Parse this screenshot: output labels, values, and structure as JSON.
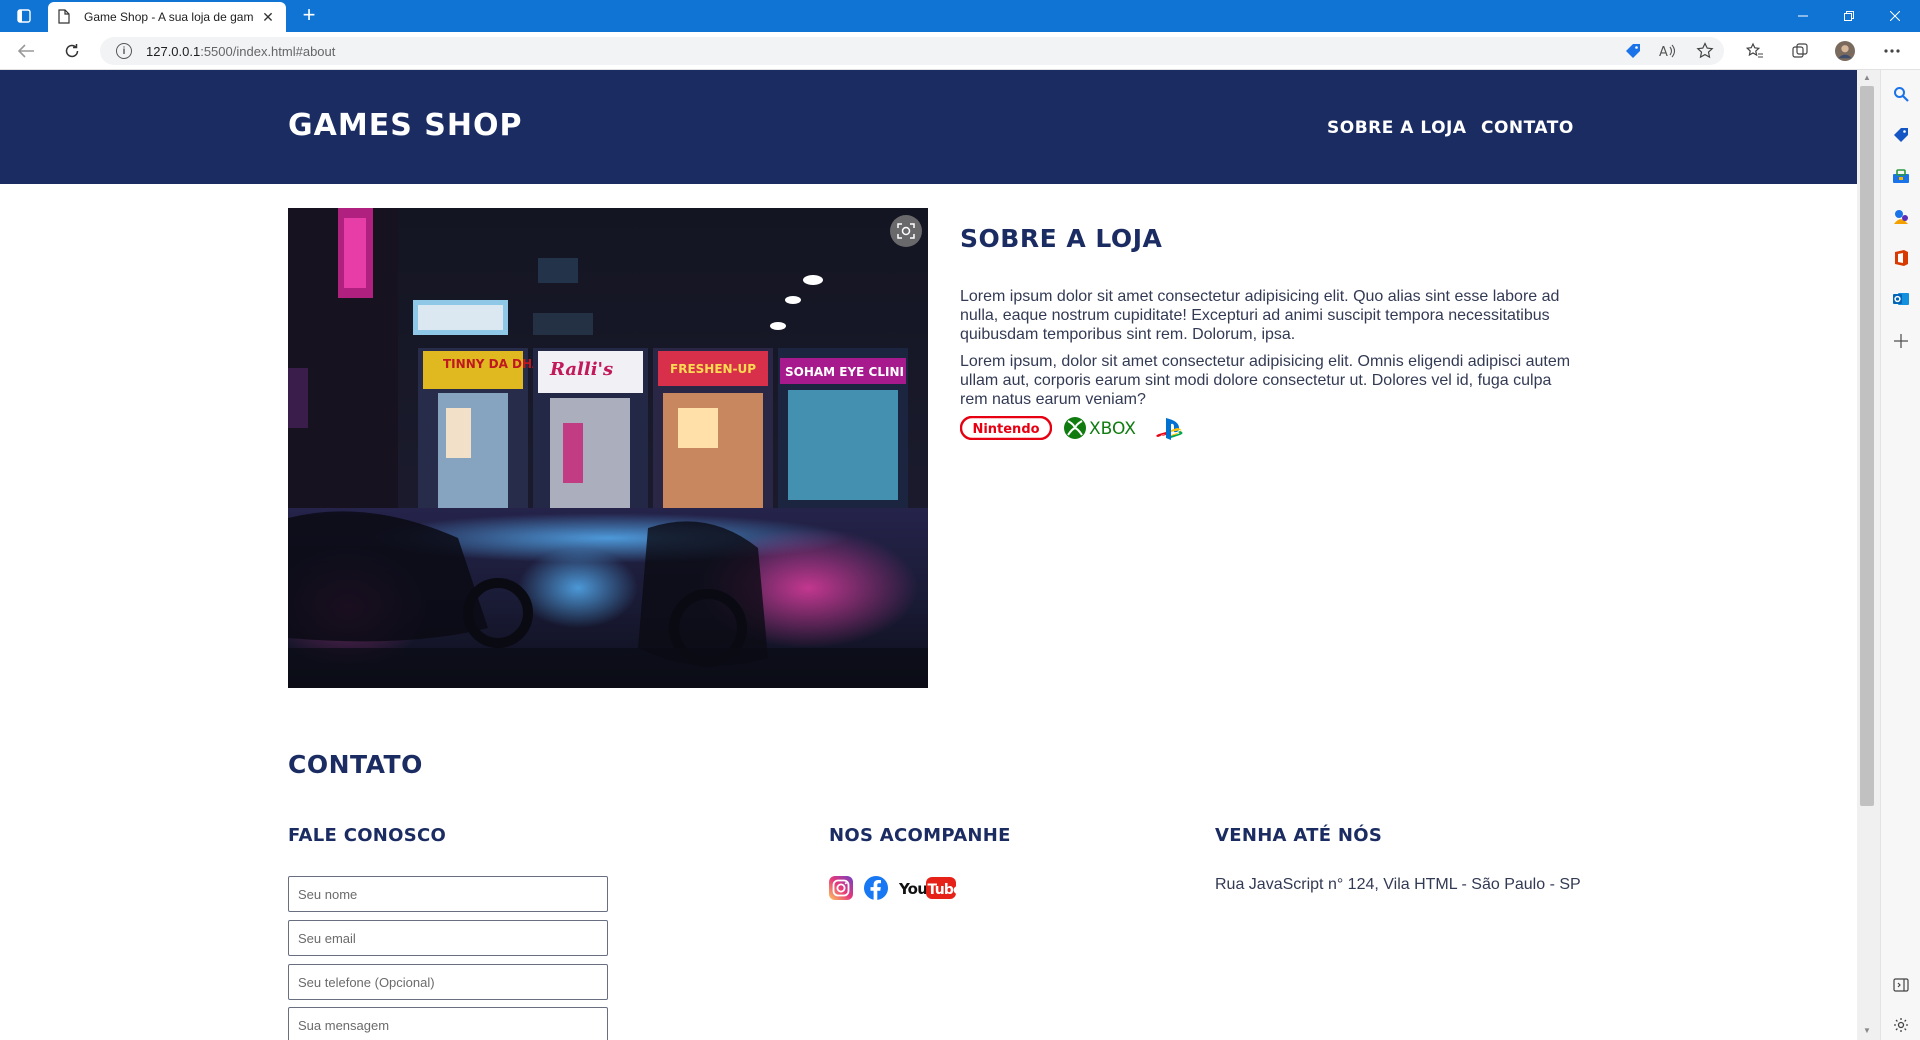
{
  "browser": {
    "tab_title": "Game Shop - A sua loja de games",
    "url_host": "127.0.0.1",
    "url_rest": ":5500/index.html#about",
    "new_tab_label": "+"
  },
  "header": {
    "logo": "Games Shop",
    "nav": [
      {
        "label": "Sobre a loja"
      },
      {
        "label": "Contato"
      }
    ]
  },
  "about": {
    "title": "Sobre a loja",
    "paragraphs": [
      "Lorem ipsum dolor sit amet consectetur adipisicing elit. Quo alias sint esse labore ad nulla, eaque nostrum cupiditate! Excepturi ad animi suscipit tempora necessitatibus quibusdam temporibus sint rem. Dolorum, ipsa.",
      "Lorem ipsum, dolor sit amet consectetur adipisicing elit. Omnis eligendi adipisci autem ullam aut, corporis earum sint modi dolore consectetur ut. Dolores vel id, fuga culpa rem natus earum veniam?"
    ],
    "brands": [
      "Nintendo",
      "XBOX",
      "PlayStation"
    ],
    "image_signs": [
      "TINNY DA DHABA",
      "Ralli's",
      "FRESHEN-UP",
      "SOHAM EYE CLINI"
    ]
  },
  "contact": {
    "title": "Contato",
    "form_title": "Fale conosco",
    "social_title": "Nos acompanhe",
    "visit_title": "Venha até nós",
    "placeholders": {
      "name": "Seu nome",
      "email": "Seu email",
      "phone": "Seu telefone (Opcional)",
      "message": "Sua mensagem"
    },
    "social": [
      "Instagram",
      "Facebook",
      "YouTube"
    ],
    "youtube_you": "You",
    "youtube_tube": "Tube",
    "address": "Rua JavaScript n° 124, Vila HTML - São Paulo - SP"
  },
  "colors": {
    "browser_blue": "#0f74d3",
    "header_navy": "#1b2c63",
    "heading_navy": "#1b2c63",
    "body_text": "#333a54",
    "nintendo_red": "#e60012",
    "xbox_green": "#107c10"
  }
}
